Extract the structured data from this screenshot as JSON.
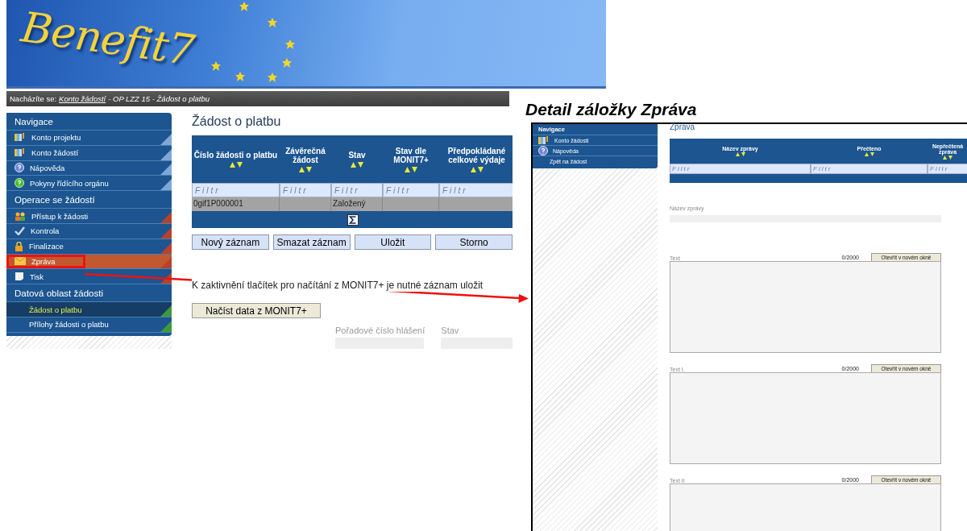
{
  "banner": {
    "logo": "Benefit7"
  },
  "breadcrumb": {
    "label": "Nacházíte se:",
    "link": "Konto žádostí",
    "rest": "- OP LZZ 15 - Žádost o platbu"
  },
  "sidebar": {
    "sections": [
      {
        "title": "Navigace",
        "color": "#7fa7d6",
        "items": [
          {
            "label": "Konto projektu",
            "kind": "book",
            "selected": false,
            "hovered": false,
            "callout": false
          },
          {
            "label": "Konto žádostí",
            "kind": "book",
            "selected": false,
            "hovered": false,
            "callout": false
          },
          {
            "label": "Nápověda",
            "kind": "help",
            "selected": false,
            "hovered": false,
            "callout": false
          },
          {
            "label": "Pokyny řídícího orgánu",
            "kind": "guide",
            "selected": false,
            "hovered": false,
            "callout": false
          }
        ]
      },
      {
        "title": "Operace se žádostí",
        "color": "#b8412c",
        "items": [
          {
            "label": "Přístup k žádosti",
            "kind": "people",
            "selected": false,
            "hovered": false,
            "callout": false
          },
          {
            "label": "Kontrola",
            "kind": "check",
            "selected": false,
            "hovered": false,
            "callout": false
          },
          {
            "label": "Finalizace",
            "kind": "lock",
            "selected": false,
            "hovered": false,
            "callout": false
          },
          {
            "label": "Zpráva",
            "kind": "envelope",
            "selected": false,
            "hovered": true,
            "callout": true
          },
          {
            "label": "Tisk",
            "kind": "page",
            "selected": false,
            "hovered": false,
            "callout": false
          }
        ]
      },
      {
        "title": "Datová oblast žádosti",
        "color": "#3d9a3d",
        "items": [
          {
            "label": "Žádost o platbu",
            "kind": "plain",
            "selected": true,
            "hovered": false,
            "callout": false
          },
          {
            "label": "Přílohy žádosti o platbu",
            "kind": "plain",
            "selected": false,
            "hovered": false,
            "callout": false
          }
        ]
      }
    ]
  },
  "main": {
    "title": "Žádost o platbu",
    "table": {
      "columns": [
        "Číslo žádosti o platbu",
        "Závěrečná žádost",
        "Stav",
        "Stav dle MONIT7+",
        "Předpokládané celkové výdaje"
      ],
      "filters": [
        {
          "placeholder": "Filtr"
        },
        {
          "placeholder": "Filtr"
        },
        {
          "placeholder": "Filtr"
        },
        {
          "placeholder": "Filtr"
        },
        {
          "placeholder": "Filtr"
        }
      ],
      "rows": [
        [
          "0gif1P000001",
          "",
          "Založený",
          "",
          ""
        ]
      ]
    },
    "buttons": [
      "Nový záznam",
      "Smazat záznam",
      "Uložit",
      "Storno"
    ],
    "note": "K zaktivnění tlačítek pro načítání z MONIT7+ je nutné záznam uložit",
    "load_button": "Načíst data z MONIT7+",
    "fields": [
      {
        "label": "Pořadové číslo hlášení",
        "disabled": true
      },
      {
        "label": "Stav",
        "disabled": true
      }
    ]
  },
  "detail": {
    "caption": "Detail záložky Zpráva",
    "sidebar": {
      "title": "Navigace",
      "items": [
        {
          "label": "Konto žádostí",
          "kind": "book"
        },
        {
          "label": "Nápověda",
          "kind": "help"
        },
        {
          "label": "Zpět na žádost",
          "kind": "plain"
        }
      ]
    },
    "title": "Zpráva",
    "table": {
      "columns": [
        "Název zprávy",
        "Přečteno",
        "Nepřečtená zpráva"
      ],
      "filters": [
        {
          "placeholder": "Filtr"
        },
        {
          "placeholder": "Filtr"
        },
        {
          "placeholder": "Filtr"
        }
      ]
    },
    "name_field": {
      "label": "Název zprávy"
    },
    "text_areas": [
      {
        "label": "Text",
        "counter": "0/2000",
        "button": "Otevřít v novém okně"
      },
      {
        "label": "Text I.",
        "counter": "0/2000",
        "button": "Otevřít v novém okně"
      },
      {
        "label": "Text II",
        "counter": "0/2000",
        "button": "Otevřít v novém okně"
      }
    ]
  }
}
